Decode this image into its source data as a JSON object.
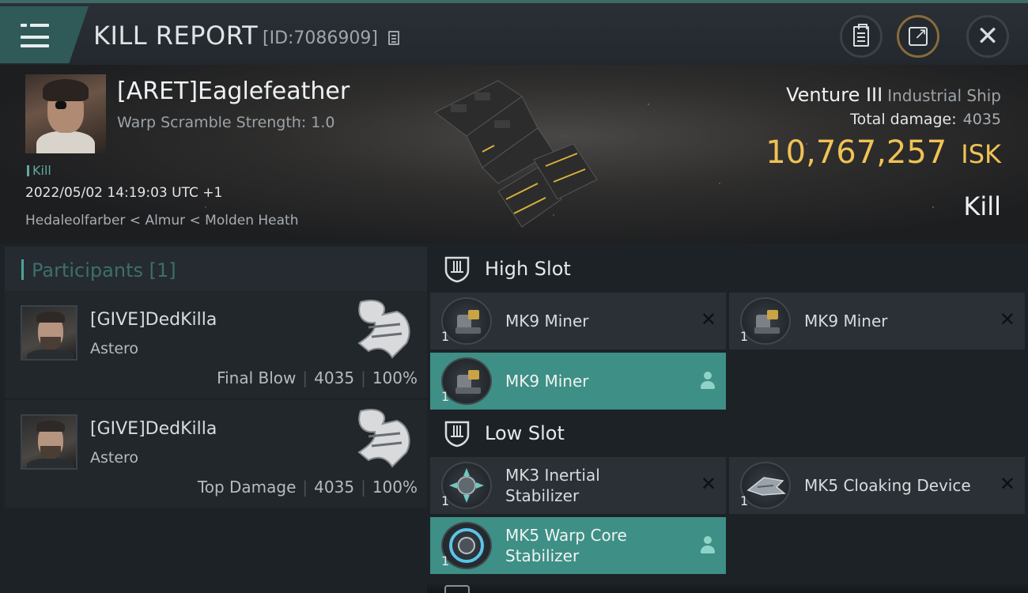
{
  "header": {
    "title": "KILL REPORT",
    "report_id": "[ID:7086909]"
  },
  "victim": {
    "name": "[ARET]Eaglefeather",
    "warp_scramble": "Warp Scramble Strength: 1.0",
    "kill_tag": "Kill",
    "timestamp": "2022/05/02 14:19:03 UTC +1",
    "location": "Hedaleolfarber < Almur < Molden Heath"
  },
  "ship": {
    "name": "Venture III",
    "class": "Industrial Ship",
    "total_damage_label": "Total damage:",
    "total_damage_value": "4035",
    "isk_value": "10,767,257",
    "isk_unit": "ISK",
    "result": "Kill"
  },
  "participants": {
    "header": "Participants [1]",
    "rows": [
      {
        "name": "[GIVE]DedKilla",
        "ship": "Astero",
        "role": "Final Blow",
        "damage": "4035",
        "percent": "100%"
      },
      {
        "name": "[GIVE]DedKilla",
        "ship": "Astero",
        "role": "Top Damage",
        "damage": "4035",
        "percent": "100%"
      }
    ]
  },
  "fitting": {
    "high_slot_label": "High Slot",
    "low_slot_label": "Low Slot",
    "high_slot": [
      {
        "name": "MK9 Miner",
        "qty": "1",
        "state": "destroyed"
      },
      {
        "name": "MK9 Miner",
        "qty": "1",
        "state": "destroyed"
      },
      {
        "name": "MK9 Miner",
        "qty": "1",
        "state": "dropped"
      }
    ],
    "low_slot": [
      {
        "name_line1": "MK3 Inertial",
        "name_line2": "Stabilizer",
        "qty": "1",
        "state": "destroyed"
      },
      {
        "name": "MK5 Cloaking Device",
        "qty": "1",
        "state": "destroyed"
      },
      {
        "name_line1": "MK5 Warp Core",
        "name_line2": "Stabilizer",
        "qty": "1",
        "state": "dropped"
      }
    ]
  },
  "colors": {
    "accent_teal": "#3e8f85",
    "isk_gold": "#f0c255",
    "background": "#1c2126"
  },
  "icons": [
    "menu-icon",
    "copy-icon",
    "clipboard-icon",
    "share-icon",
    "close-icon",
    "slot-icon",
    "destroyed-x-icon",
    "person-icon"
  ]
}
